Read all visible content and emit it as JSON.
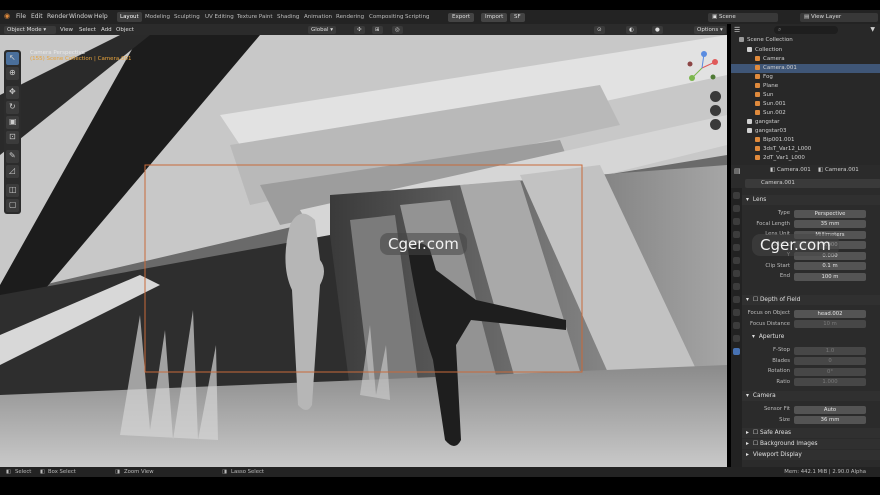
{
  "menus": [
    "File",
    "Edit",
    "Render",
    "Window",
    "Help"
  ],
  "workspaces": [
    "Layout",
    "Modeling",
    "Sculpting",
    "UV Editing",
    "Texture Paint",
    "Shading",
    "Animation",
    "Rendering",
    "Compositing",
    "Scripting"
  ],
  "workspace_active": "Layout",
  "header_buttons": {
    "export": "Export",
    "import": "Import",
    "sf": "SF"
  },
  "scene": {
    "label": "Scene",
    "view_layer": "View Layer"
  },
  "viewport_header": {
    "mode": "Object Mode",
    "view": "View",
    "select": "Select",
    "add": "Add",
    "object": "Object",
    "orientation": "Global",
    "options": "Options"
  },
  "viewport_info": {
    "line1": "Camera Perspective",
    "line2": "(155) Scene Collection | Camera.001"
  },
  "outliner": {
    "root": "Scene Collection",
    "items": [
      {
        "label": "Collection",
        "depth": 1,
        "color": "#d0d0d0",
        "selected": false
      },
      {
        "label": "Camera",
        "depth": 2,
        "color": "#e08a3c",
        "selected": false
      },
      {
        "label": "Camera.001",
        "depth": 2,
        "color": "#e08a3c",
        "selected": true
      },
      {
        "label": "Fog",
        "depth": 2,
        "color": "#e08a3c",
        "selected": false
      },
      {
        "label": "Plane",
        "depth": 2,
        "color": "#e08a3c",
        "selected": false
      },
      {
        "label": "Sun",
        "depth": 2,
        "color": "#e08a3c",
        "selected": false
      },
      {
        "label": "Sun.001",
        "depth": 2,
        "color": "#e08a3c",
        "selected": false
      },
      {
        "label": "Sun.002",
        "depth": 2,
        "color": "#e08a3c",
        "selected": false
      },
      {
        "label": "gangstar",
        "depth": 1,
        "color": "#d0d0d0",
        "selected": false
      },
      {
        "label": "gangstar03",
        "depth": 1,
        "color": "#d0d0d0",
        "selected": false
      },
      {
        "label": "Bip001.001",
        "depth": 2,
        "color": "#e08a3c",
        "selected": false
      },
      {
        "label": "3dsT_Var12_L000",
        "depth": 2,
        "color": "#e08a3c",
        "selected": false
      },
      {
        "label": "2dT_Var1_L000",
        "depth": 2,
        "color": "#e08a3c",
        "selected": false
      }
    ]
  },
  "properties": {
    "tabs": [
      "Camera.001",
      "Camera.001"
    ],
    "data_name": "Camera.001",
    "lens_section": "Lens",
    "lens_rows": [
      {
        "label": "Type",
        "value": "Perspective",
        "dim": false
      },
      {
        "label": "Focal Length",
        "value": "35 mm",
        "dim": false
      },
      {
        "label": "Lens Unit",
        "value": "Millimeters",
        "dim": false
      },
      {
        "label": "Shift X",
        "value": "0.000",
        "dim": false
      },
      {
        "label": "Y",
        "value": "0.000",
        "dim": false
      },
      {
        "label": "Clip Start",
        "value": "0.1 m",
        "dim": false
      },
      {
        "label": "End",
        "value": "100 m",
        "dim": false
      }
    ],
    "dof_section": "Depth of Field",
    "dof_rows": [
      {
        "label": "Focus on Object",
        "value": "head.002",
        "dim": false
      },
      {
        "label": "Focus Distance",
        "value": "10 m",
        "dim": true
      }
    ],
    "aperture_section": "Aperture",
    "aperture_rows": [
      {
        "label": "F-Stop",
        "value": "1.0",
        "dim": true
      },
      {
        "label": "Blades",
        "value": "0",
        "dim": true
      },
      {
        "label": "Rotation",
        "value": "0°",
        "dim": true
      },
      {
        "label": "Ratio",
        "value": "1.000",
        "dim": true
      }
    ],
    "camera_section": "Camera",
    "camera_rows": [
      {
        "label": "Sensor Fit",
        "value": "Auto",
        "dim": false
      },
      {
        "label": "Size",
        "value": "36 mm",
        "dim": false
      }
    ],
    "safe_areas": "Safe Areas",
    "background_images": "Background Images",
    "viewport_display": "Viewport Display"
  },
  "statusbar": {
    "select": "Select",
    "box_select": "Box Select",
    "zoom_view": "Zoom View",
    "lasso_select": "Lasso Select",
    "memory": "Mem: 442.1 MiB | 2.90.0 Alpha"
  },
  "watermark": "Cger.com",
  "colors": {
    "accent": "#4772b3",
    "selection": "#3f5677",
    "camera_frame": "#c86a3a"
  }
}
